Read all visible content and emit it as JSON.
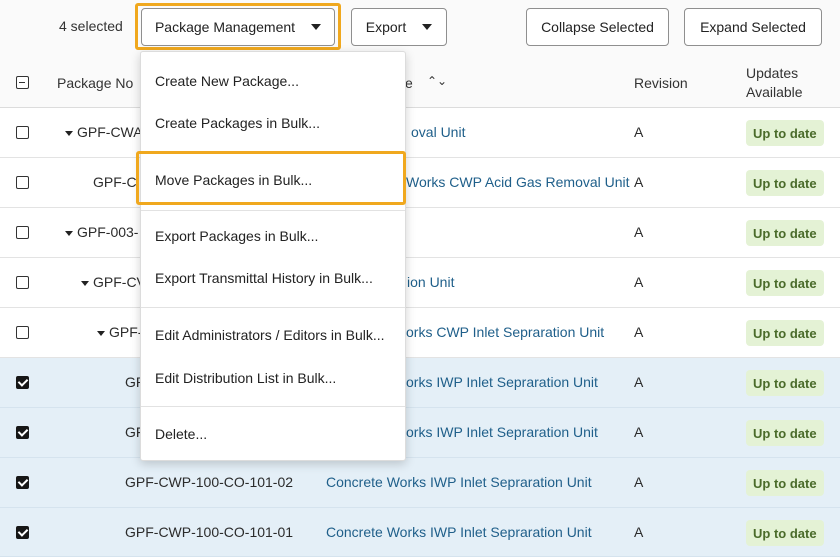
{
  "toolbar": {
    "selected_count": "4 selected",
    "package_management_label": "Package Management",
    "export_label": "Export",
    "collapse_label": "Collapse Selected",
    "expand_label": "Expand Selected"
  },
  "table": {
    "headers": {
      "package_no": "Package No",
      "name_suffix": "e",
      "revision": "Revision",
      "updates_line1": "Updates",
      "updates_line2": "Available"
    },
    "rows": [
      {
        "checked": false,
        "package_no": "GPF-CWA",
        "name": "oval Unit",
        "revision": "A",
        "status": "Up to date"
      },
      {
        "checked": false,
        "package_no": "GPF-C",
        "name": "Works CWP Acid Gas Removal Unit",
        "revision": "A",
        "status": "Up to date"
      },
      {
        "checked": false,
        "package_no": "GPF-003-",
        "name": "",
        "revision": "A",
        "status": "Up to date"
      },
      {
        "checked": false,
        "package_no": "GPF-CV",
        "name": "ion Unit",
        "revision": "A",
        "status": "Up to date"
      },
      {
        "checked": false,
        "package_no": "GPF-",
        "name": "orks CWP Inlet Sepraration Unit",
        "revision": "A",
        "status": "Up to date"
      },
      {
        "checked": true,
        "package_no": "GPF",
        "name": "orks IWP Inlet Sepraration Unit",
        "revision": "A",
        "status": "Up to date"
      },
      {
        "checked": true,
        "package_no": "GF",
        "name": "orks IWP Inlet Sepraration Unit",
        "revision": "A",
        "status": "Up to date"
      },
      {
        "checked": true,
        "package_no": "GPF-CWP-100-CO-101-02",
        "name": "Concrete Works IWP Inlet Sepraration Unit",
        "revision": "A",
        "status": "Up to date"
      },
      {
        "checked": true,
        "package_no": "GPF-CWP-100-CO-101-01",
        "name": "Concrete Works IWP Inlet Sepraration Unit",
        "revision": "A",
        "status": "Up to date"
      }
    ]
  },
  "menu": {
    "items": [
      "Create New Package...",
      "Create Packages in Bulk...",
      "Move Packages in Bulk...",
      "Export Packages in Bulk...",
      "Export Transmittal History in Bulk...",
      "Edit Administrators / Editors in Bulk...",
      "Edit Distribution List in Bulk...",
      "Delete..."
    ]
  },
  "colors": {
    "highlight": "#f0a81e",
    "link": "#1f5f8a",
    "badge_bg": "#e4f2d5",
    "selected_row": "#e4eff7"
  }
}
